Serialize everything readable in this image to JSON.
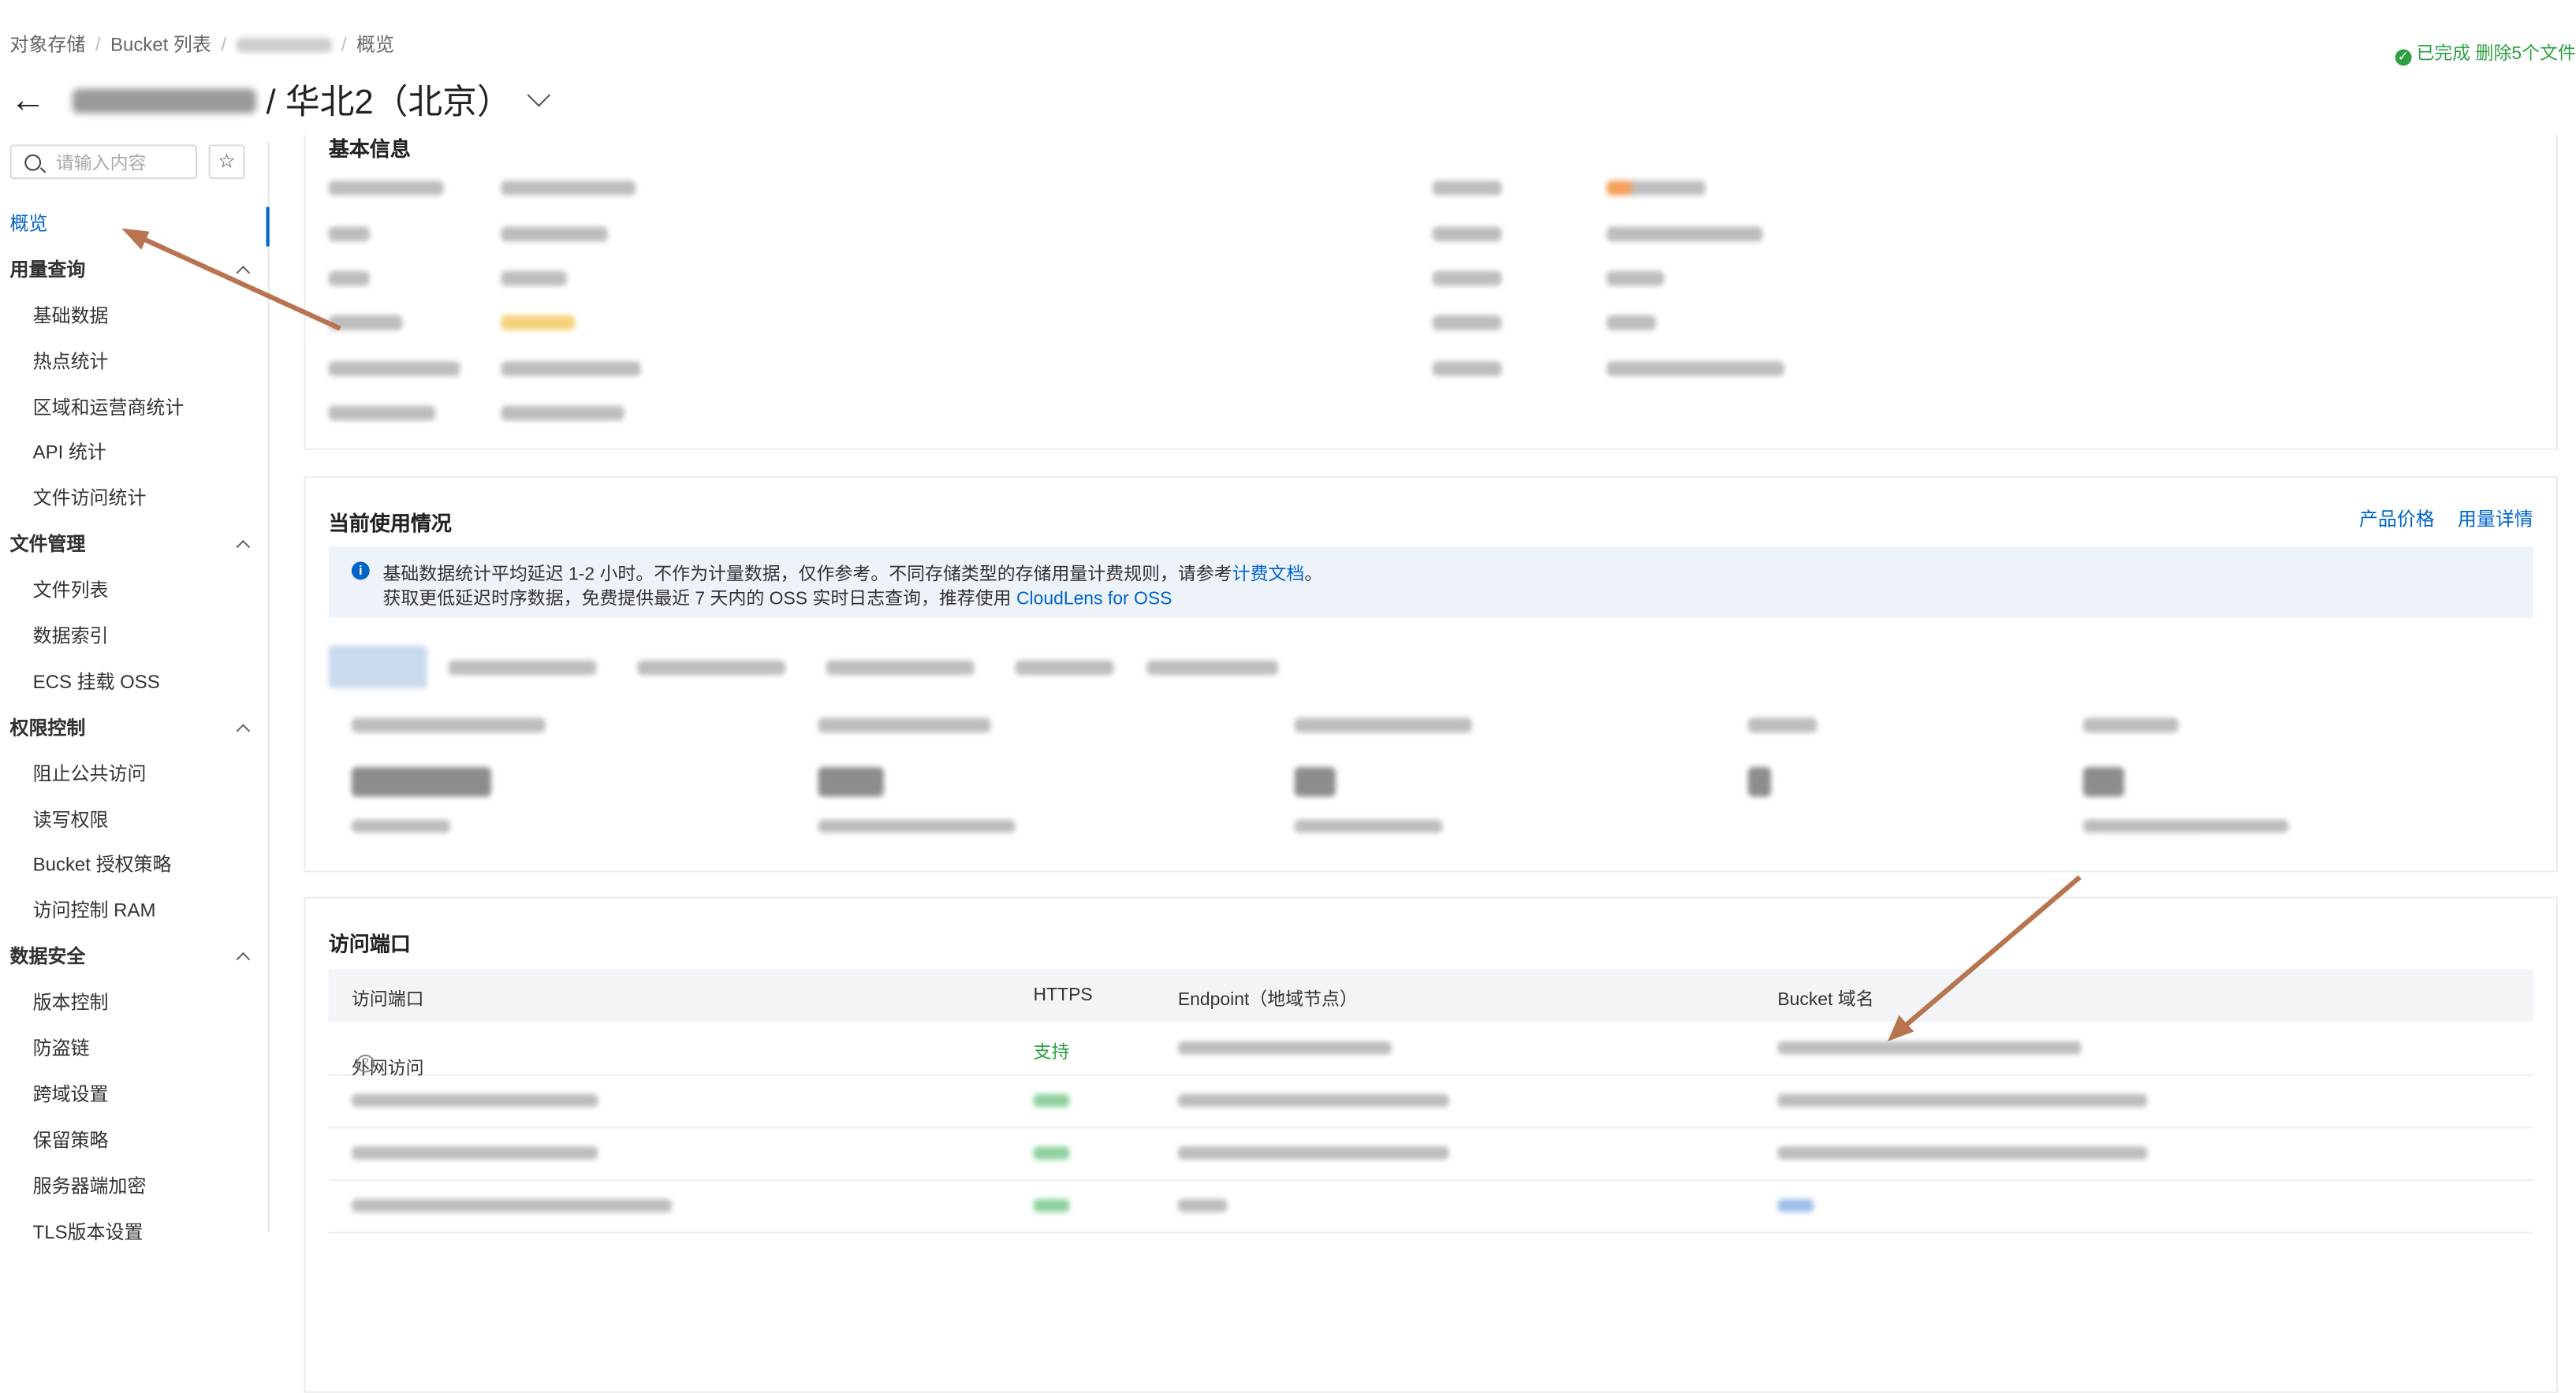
{
  "breadcrumb": {
    "root": "对象存储",
    "list": "Bucket 列表",
    "current": "概览"
  },
  "status": {
    "text": "已完成 删除5个文件"
  },
  "header": {
    "title_suffix": "/ 华北2（北京）"
  },
  "sidebar": {
    "search_placeholder": "请输入内容",
    "items": [
      {
        "label": "概览",
        "type": "active"
      },
      {
        "label": "用量查询",
        "type": "group"
      },
      {
        "label": "基础数据",
        "type": "sub"
      },
      {
        "label": "热点统计",
        "type": "sub"
      },
      {
        "label": "区域和运营商统计",
        "type": "sub"
      },
      {
        "label": "API 统计",
        "type": "sub"
      },
      {
        "label": "文件访问统计",
        "type": "sub"
      },
      {
        "label": "文件管理",
        "type": "group"
      },
      {
        "label": "文件列表",
        "type": "sub"
      },
      {
        "label": "数据索引",
        "type": "sub"
      },
      {
        "label": "ECS 挂载 OSS",
        "type": "sub"
      },
      {
        "label": "权限控制",
        "type": "group"
      },
      {
        "label": "阻止公共访问",
        "type": "sub"
      },
      {
        "label": "读写权限",
        "type": "sub"
      },
      {
        "label": "Bucket 授权策略",
        "type": "sub"
      },
      {
        "label": "访问控制 RAM",
        "type": "sub"
      },
      {
        "label": "数据安全",
        "type": "group"
      },
      {
        "label": "版本控制",
        "type": "sub"
      },
      {
        "label": "防盗链",
        "type": "sub"
      },
      {
        "label": "跨域设置",
        "type": "sub"
      },
      {
        "label": "保留策略",
        "type": "sub"
      },
      {
        "label": "服务器端加密",
        "type": "sub"
      },
      {
        "label": "TLS版本设置",
        "type": "sub"
      }
    ]
  },
  "basic_info": {
    "title": "基本信息"
  },
  "usage": {
    "title": "当前使用情况",
    "link_price": "产品价格",
    "link_detail": "用量详情",
    "notice_line1_pre": "基础数据统计平均延迟 1-2 小时。不作为计量数据，仅作参考。不同存储类型的存储用量计费规则，请参考",
    "notice_line1_link": "计费文档",
    "notice_line1_post": "。",
    "notice_line2_pre": "获取更低延迟时序数据，免费提供最近 7 天内的 OSS 实时日志查询，推荐使用",
    "notice_line2_link": "CloudLens for OSS"
  },
  "access": {
    "title": "访问端口",
    "columns": [
      "访问端口",
      "HTTPS",
      "Endpoint（地域节点）",
      "Bucket 域名"
    ],
    "row1": {
      "port": "外网访问",
      "https": "支持"
    }
  },
  "colors": {
    "accent": "#0064c8",
    "success": "#2ea043",
    "arrow": "#b8744e"
  }
}
